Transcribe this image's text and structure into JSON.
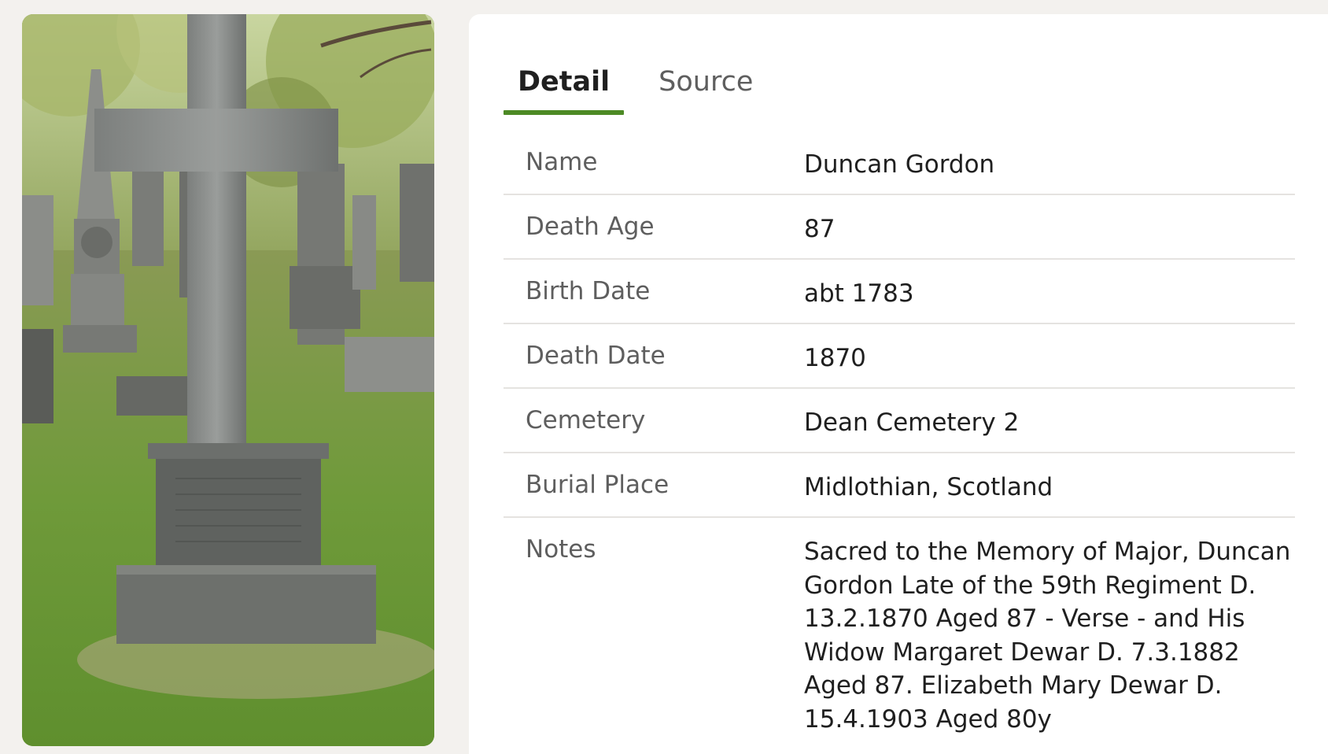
{
  "photo": {
    "alt_icon": "gravestone-photo"
  },
  "tabs": [
    {
      "label": "Detail",
      "active": true
    },
    {
      "label": "Source",
      "active": false
    }
  ],
  "fields": {
    "name": {
      "label": "Name",
      "value": "Duncan Gordon"
    },
    "death_age": {
      "label": "Death Age",
      "value": "87"
    },
    "birth_date": {
      "label": "Birth Date",
      "value": "abt 1783"
    },
    "death_date": {
      "label": "Death Date",
      "value": "1870"
    },
    "cemetery": {
      "label": "Cemetery",
      "value": "Dean Cemetery 2"
    },
    "burial_place": {
      "label": "Burial Place",
      "value": "Midlothian, Scotland"
    },
    "notes": {
      "label": "Notes",
      "value": "Sacred to the Memory of Major, Duncan Gordon Late of the 59th Regiment D. 13.2.1870 Aged 87 - Verse - and His Widow Margaret Dewar D. 7.3.1882 Aged 87. Elizabeth Mary Dewar D. 15.4.1903 Aged 80y"
    }
  },
  "colors": {
    "accent": "#4d8a25",
    "page_bg": "#f3f1ee",
    "card_bg": "#ffffff",
    "label_text": "#5e5e5e",
    "value_text": "#1f1f1f",
    "divider": "#e5e3e0"
  }
}
